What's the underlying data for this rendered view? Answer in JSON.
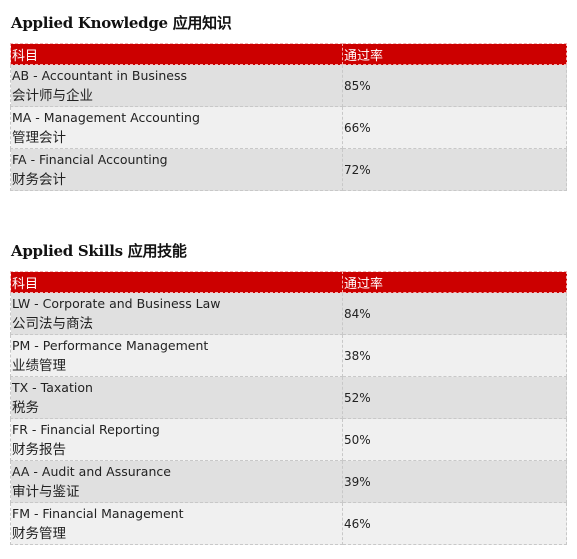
{
  "sections": [
    {
      "title": "Applied Knowledge 应用知识",
      "headers": [
        "科目",
        "通过率"
      ],
      "rows": [
        {
          "code_name": "AB - Accountant in Business",
          "zh_name": "会计师与企业",
          "pass_rate": "85%"
        },
        {
          "code_name": "MA - Management Accounting",
          "zh_name": "管理会计",
          "pass_rate": "66%"
        },
        {
          "code_name": "FA - Financial Accounting",
          "zh_name": "财务会计",
          "pass_rate": "72%"
        }
      ]
    },
    {
      "title": "Applied Skills 应用技能",
      "headers": [
        "科目",
        "通过率"
      ],
      "rows": [
        {
          "code_name": "LW - Corporate and Business Law",
          "zh_name": "公司法与商法",
          "pass_rate": "84%"
        },
        {
          "code_name": "PM - Performance Management",
          "zh_name": "业绩管理",
          "pass_rate": "38%"
        },
        {
          "code_name": "TX - Taxation",
          "zh_name": "税务",
          "pass_rate": "52%"
        },
        {
          "code_name": "FR - Financial Reporting",
          "zh_name": "财务报告",
          "pass_rate": "50%"
        },
        {
          "code_name": "AA - Audit and Assurance",
          "zh_name": "审计与鉴证",
          "pass_rate": "39%"
        },
        {
          "code_name": "FM - Financial Management",
          "zh_name": "财务管理",
          "pass_rate": "46%"
        }
      ]
    }
  ],
  "colors": {
    "header_bg": "#cc0000",
    "row_odd_bg": "#e0e0e0",
    "row_even_bg": "#f0f0f0"
  }
}
